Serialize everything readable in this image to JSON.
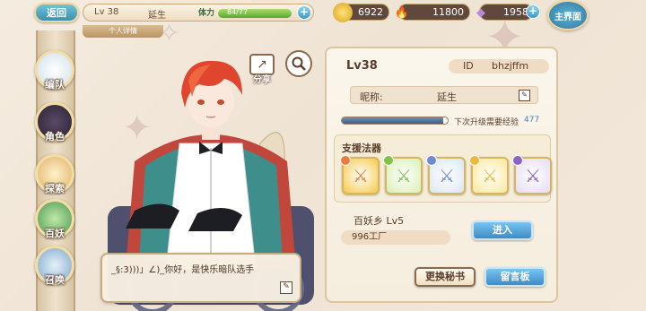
{
  "topbar": {
    "back_label": "返回",
    "level": "Lv 38",
    "name": "延生",
    "stamina_label": "体力",
    "stamina_value": "84/77",
    "stamina_fraction": 1.0,
    "gold": "6922",
    "gems": "11800",
    "crystals": "1958",
    "home_label": "主界面"
  },
  "tab_label": "个人详情",
  "sidebar": {
    "items": [
      {
        "label": "编队",
        "icon": "ghost-icon",
        "color": "#e9eef2"
      },
      {
        "label": "角色",
        "icon": "character-icon",
        "color": "#3a3042"
      },
      {
        "label": "探索",
        "icon": "scroll-icon",
        "color": "#e9c48a"
      },
      {
        "label": "百妖",
        "icon": "realm-icon",
        "color": "#6bb36d"
      },
      {
        "label": "召唤",
        "icon": "summon-icon",
        "color": "#7fa7c9"
      }
    ]
  },
  "share_label": "分享",
  "dialogue": "_§:3)))」∠)_你好，是快乐暗队选手",
  "profile": {
    "level": "Lv38",
    "id_label": "ID",
    "id_value": "bhzjffm",
    "nickname_label": "昵称:",
    "nickname": "延生",
    "exp_fraction": 0.96,
    "exp_label": "下次升级需要经验",
    "exp_value": "477",
    "artifact_title": "支援法器",
    "artifacts": [
      {
        "name": "dark-banner-artifact",
        "bg": "#f7c948",
        "gem": "#ef7a3d"
      },
      {
        "name": "green-spear-artifact",
        "bg": "#d8efb4",
        "gem": "#7fc34a"
      },
      {
        "name": "blue-sword-artifact",
        "bg": "#d9e6f3",
        "gem": "#6d8ad4"
      },
      {
        "name": "golden-wing-artifact",
        "bg": "#fbe79a",
        "gem": "#f0b83a"
      },
      {
        "name": "purple-sword-artifact",
        "bg": "#e5dbf3",
        "gem": "#8a63c9"
      }
    ],
    "realm_name": "百妖乡  Lv5",
    "realm_value": "996工厂",
    "enter_label": "进入",
    "change_secretary_label": "更换秘书",
    "message_board_label": "留言板"
  }
}
